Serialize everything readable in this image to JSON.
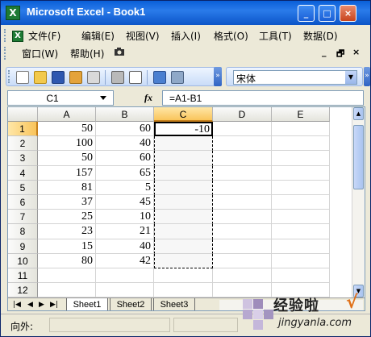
{
  "window": {
    "title": "Microsoft Excel - Book1",
    "app_icon": "excel-icon",
    "controls": {
      "minimize": "_",
      "restore": "□",
      "close": "×"
    }
  },
  "menubar": {
    "items": [
      {
        "label": "文件(F)"
      },
      {
        "label": "编辑(E)"
      },
      {
        "label": "视图(V)"
      },
      {
        "label": "插入(I)"
      },
      {
        "label": "格式(O)"
      },
      {
        "label": "工具(T)"
      },
      {
        "label": "数据(D)"
      }
    ],
    "items2": [
      {
        "label": "窗口(W)"
      },
      {
        "label": "帮助(H)"
      }
    ],
    "doc_controls": {
      "minimize": "_",
      "restore": "🗗",
      "close": "×"
    }
  },
  "toolbar": {
    "icons": [
      "new-icon",
      "open-icon",
      "save-icon",
      "permission-icon",
      "email-icon",
      "print-icon",
      "print-preview-icon",
      "spelling-icon",
      "research-icon"
    ],
    "font_name": "宋体"
  },
  "formula_bar": {
    "name_box": "C1",
    "fx": "fx",
    "formula": "=A1-B1"
  },
  "sheet": {
    "columns": [
      "A",
      "B",
      "C",
      "D",
      "E"
    ],
    "selected_column": "C",
    "selected_row": "1",
    "rows": [
      {
        "row": "1",
        "A": "50",
        "B": "60",
        "C": "-10"
      },
      {
        "row": "2",
        "A": "100",
        "B": "40",
        "C": ""
      },
      {
        "row": "3",
        "A": "50",
        "B": "60",
        "C": ""
      },
      {
        "row": "4",
        "A": "157",
        "B": "65",
        "C": ""
      },
      {
        "row": "5",
        "A": "81",
        "B": "5",
        "C": ""
      },
      {
        "row": "6",
        "A": "37",
        "B": "45",
        "C": ""
      },
      {
        "row": "7",
        "A": "25",
        "B": "10",
        "C": ""
      },
      {
        "row": "8",
        "A": "23",
        "B": "21",
        "C": ""
      },
      {
        "row": "9",
        "A": "15",
        "B": "40",
        "C": ""
      },
      {
        "row": "10",
        "A": "80",
        "B": "42",
        "C": ""
      },
      {
        "row": "11",
        "A": "",
        "B": "",
        "C": ""
      },
      {
        "row": "12",
        "A": "",
        "B": "",
        "C": ""
      }
    ],
    "tabs": [
      "Sheet1",
      "Sheet2",
      "Sheet3"
    ],
    "active_tab": "Sheet1"
  },
  "statusbar": {
    "text": "向外:"
  },
  "watermark": {
    "title": "经验啦",
    "check": "√",
    "url": "jingyanla.com"
  }
}
